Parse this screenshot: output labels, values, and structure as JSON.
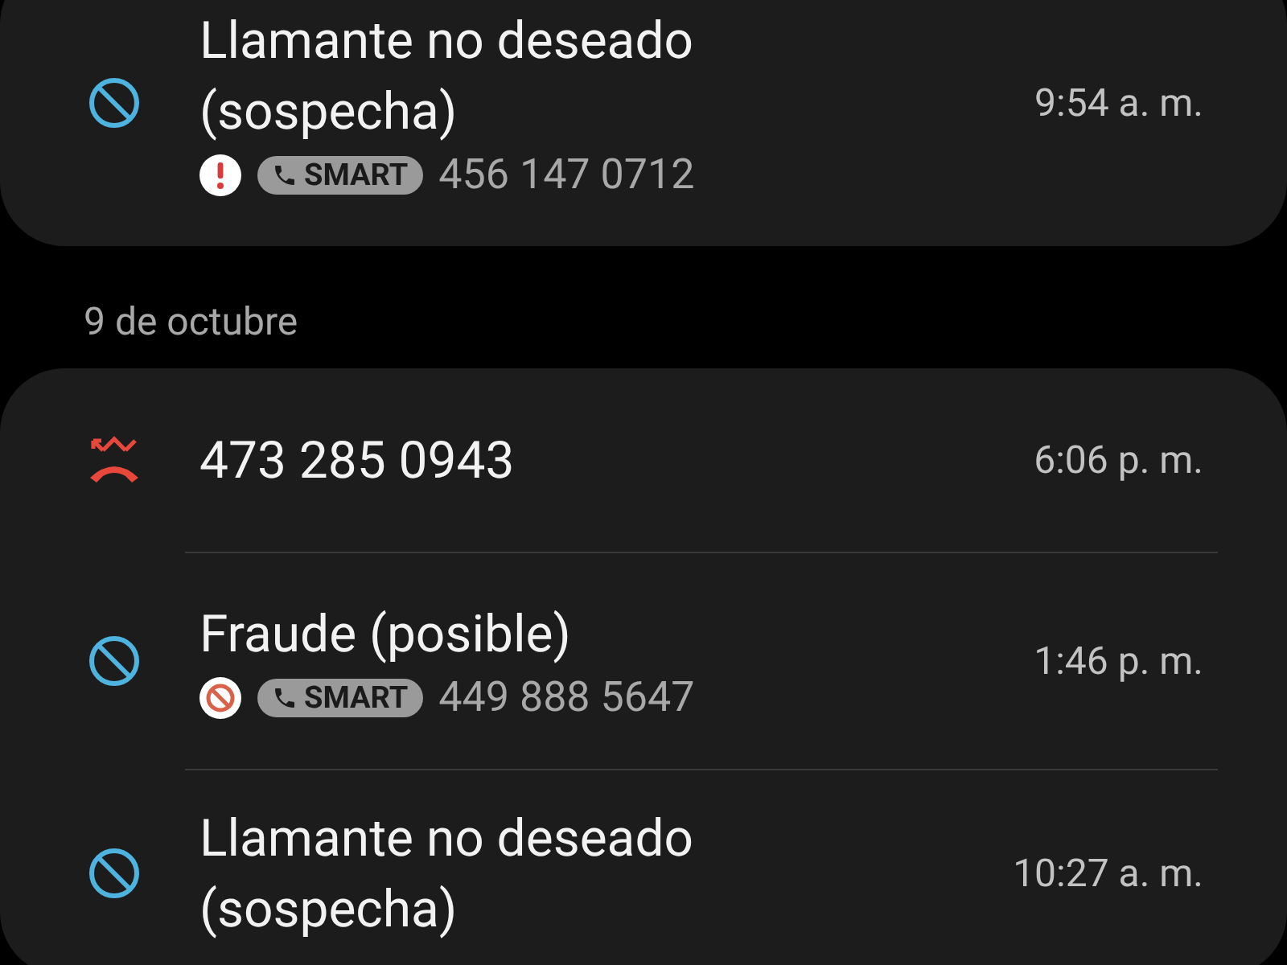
{
  "groups": [
    {
      "calls": [
        {
          "kind": "blocked",
          "title": "Llamante no deseado (sospecha)",
          "time": "9:54 a. m.",
          "alert": {
            "kind": "warning"
          },
          "tag": "SMART",
          "number": "456 147 0712"
        }
      ]
    },
    {
      "date": "9 de octubre",
      "calls": [
        {
          "kind": "missed",
          "title": "473 285 0943",
          "time": "6:06 p. m."
        },
        {
          "kind": "blocked",
          "title": "Fraude (posible)",
          "time": "1:46 p. m.",
          "alert": {
            "kind": "blocked"
          },
          "tag": "SMART",
          "number": "449 888 5647"
        },
        {
          "kind": "blocked",
          "title": "Llamante no deseado (sospecha)",
          "time": "10:27 a. m."
        }
      ]
    }
  ]
}
